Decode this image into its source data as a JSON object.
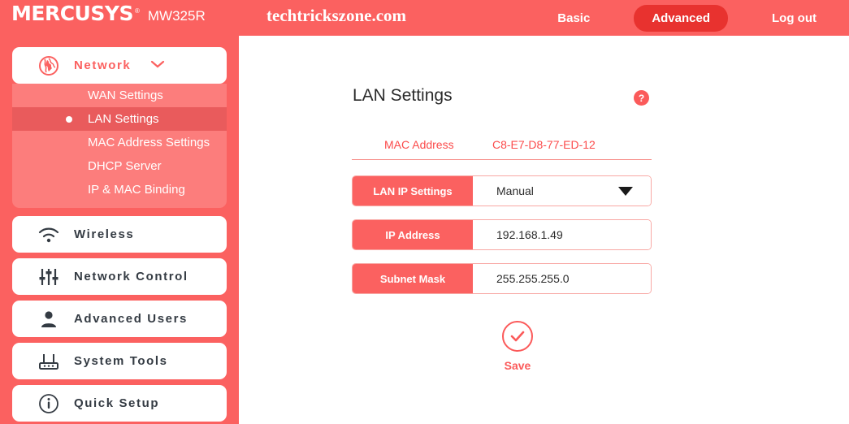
{
  "header": {
    "brand": "MERCUSYS",
    "registered_mark": "®",
    "model": "MW325R",
    "watermark": "techtrickszone.com",
    "nav": [
      {
        "label": "Basic",
        "active": false
      },
      {
        "label": "Advanced",
        "active": true
      },
      {
        "label": "Log out",
        "active": false
      }
    ]
  },
  "sidebar": {
    "groups": [
      {
        "label": "Network",
        "icon": "globe-icon",
        "expanded": true,
        "chevron": "⌄",
        "items": [
          {
            "label": "WAN Settings",
            "active": false
          },
          {
            "label": "LAN Settings",
            "active": true
          },
          {
            "label": "MAC Address Settings",
            "active": false
          },
          {
            "label": "DHCP Server",
            "active": false
          },
          {
            "label": "IP & MAC Binding",
            "active": false
          }
        ]
      },
      {
        "label": "Wireless",
        "icon": "wifi-icon",
        "expanded": false
      },
      {
        "label": "Network Control",
        "icon": "sliders-icon",
        "expanded": false
      },
      {
        "label": "Advanced Users",
        "icon": "user-icon",
        "expanded": false
      },
      {
        "label": "System Tools",
        "icon": "router-icon",
        "expanded": false
      },
      {
        "label": "Quick Setup",
        "icon": "info-circle-icon",
        "expanded": false
      }
    ]
  },
  "main": {
    "title": "LAN Settings",
    "help_label": "?",
    "mac": {
      "label": "MAC Address",
      "value": "C8-E7-D8-77-ED-12"
    },
    "fields": [
      {
        "label": "LAN IP Settings",
        "value": "Manual",
        "type": "select"
      },
      {
        "label": "IP Address",
        "value": "192.168.1.49",
        "type": "text"
      },
      {
        "label": "Subnet Mask",
        "value": "255.255.255.0",
        "type": "text"
      }
    ],
    "save_label": "Save"
  },
  "colors": {
    "brand_red": "#fb6160",
    "accent_dark_red": "#e8322f",
    "submenu_light": "#fc7d7c",
    "submenu_active": "#e95b5c",
    "text_dark": "#343b43"
  }
}
